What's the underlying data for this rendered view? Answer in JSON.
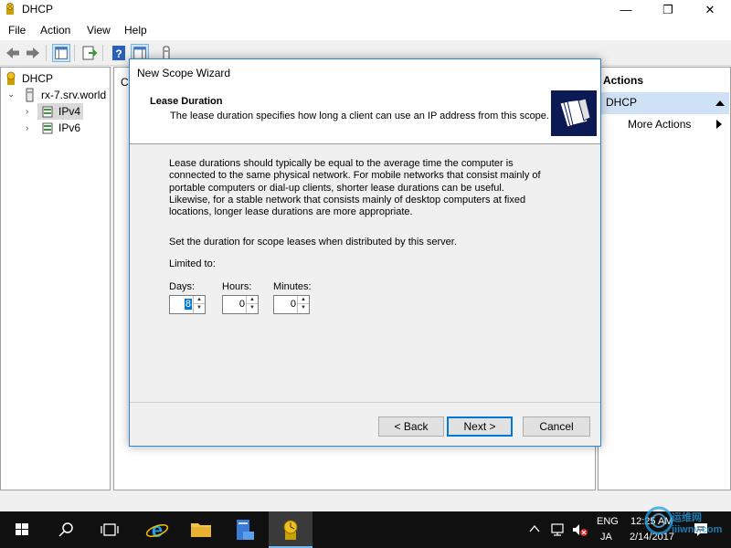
{
  "window": {
    "title": "DHCP",
    "icon": "dhcp-icon",
    "controls": [
      "—",
      "❐",
      "✕"
    ]
  },
  "menu": [
    "File",
    "Action",
    "View",
    "Help"
  ],
  "toolbar_icons": [
    "back-arrow-icon",
    "forward-arrow-icon",
    "console-tree-icon",
    "export-list-icon",
    "help-icon",
    "action-pane-icon",
    "server-icon"
  ],
  "tree": {
    "root": "DHCP",
    "server": "rx-7.srv.world",
    "ipv4": "IPv4",
    "ipv6": "IPv6"
  },
  "center_pane_clip": "C",
  "actions": {
    "title": "Actions",
    "section": "DHCP",
    "more_actions": "More Actions"
  },
  "wizard": {
    "title": "New Scope Wizard",
    "header_title": "Lease Duration",
    "header_subtitle": "The lease duration specifies how long a client can use an IP address from this scope.",
    "paragraph_lines": [
      "Lease durations should typically be equal to the average time the computer is",
      "connected to the same physical network. For mobile networks that consist mainly of",
      "portable computers or dial-up clients, shorter lease durations can be useful.",
      "Likewise, for a stable network that consists mainly of desktop computers at fixed",
      "locations, longer lease durations are more appropriate."
    ],
    "set_duration": "Set the duration for scope leases when distributed by this server.",
    "limited_to": "Limited to:",
    "days_label": "Days:",
    "days_value": "8",
    "hours_label": "Hours:",
    "hours_value": "0",
    "minutes_label": "Minutes:",
    "minutes_value": "0",
    "back_label": "< Back",
    "next_label": "Next >",
    "cancel_label": "Cancel"
  },
  "taskbar": {
    "icons": [
      "windows-start-icon",
      "search-icon",
      "task-view-icon",
      "internet-explorer-icon",
      "file-explorer-icon",
      "server-manager-icon",
      "dhcp-taskbar-icon"
    ],
    "lang_top": "ENG",
    "lang_bottom": "JA",
    "time": "12:25 AM",
    "date": "2/14/2017",
    "watermark": "运维网 iiiwnv.com"
  },
  "colors": {
    "accent": "#0078d7",
    "wizard_border": "#2a86d4",
    "actions_highlight": "#cfe2f5",
    "taskbar": "#101010"
  }
}
